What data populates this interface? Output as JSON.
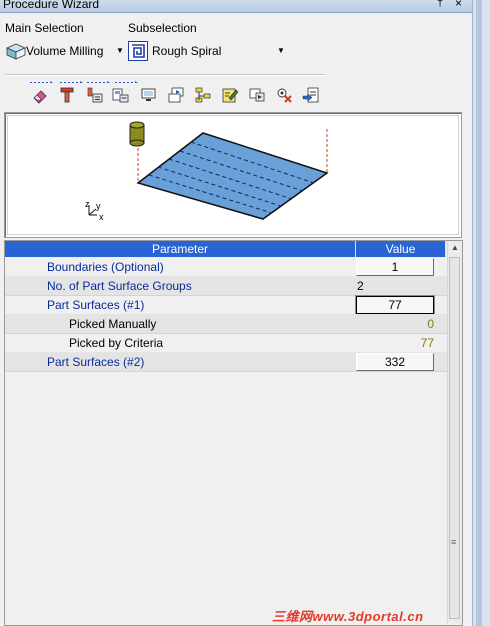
{
  "window": {
    "title": "Procedure Wizard",
    "pin_glyph": "†",
    "close_glyph": "×"
  },
  "main_selection": {
    "label": "Main Selection",
    "value": "Volume Milling"
  },
  "subselection": {
    "label": "Subselection",
    "value": "Rough Spiral"
  },
  "toolbar": {
    "icons": [
      "eraser-icon",
      "tool-icon",
      "tool-parameters-icon",
      "machine-icon",
      "monitor-icon",
      "transfer-icon",
      "tree-icon",
      "edit-icon",
      "simulate-icon",
      "settings-icon",
      "export-icon"
    ]
  },
  "grid": {
    "headers": {
      "parameter": "Parameter",
      "value": "Value"
    },
    "rows": [
      {
        "name": "Boundaries (Optional)",
        "value": "1"
      },
      {
        "name": "No. of Part Surface Groups",
        "value": "2"
      },
      {
        "name": "Part Surfaces (#1)",
        "value": "77"
      },
      {
        "name": "Picked Manually",
        "value": "0"
      },
      {
        "name": "Picked by Criteria",
        "value": "77"
      },
      {
        "name": "Part Surfaces (#2)",
        "value": "332"
      }
    ]
  },
  "preview": {
    "axis_x": "x",
    "axis_y": "y",
    "axis_z": "z"
  },
  "watermark": "三维网www.3dportal.cn",
  "colors": {
    "header_blue": "#2a63d4",
    "param_text": "#0a2a9c",
    "readonly_value": "#8a7a10"
  }
}
